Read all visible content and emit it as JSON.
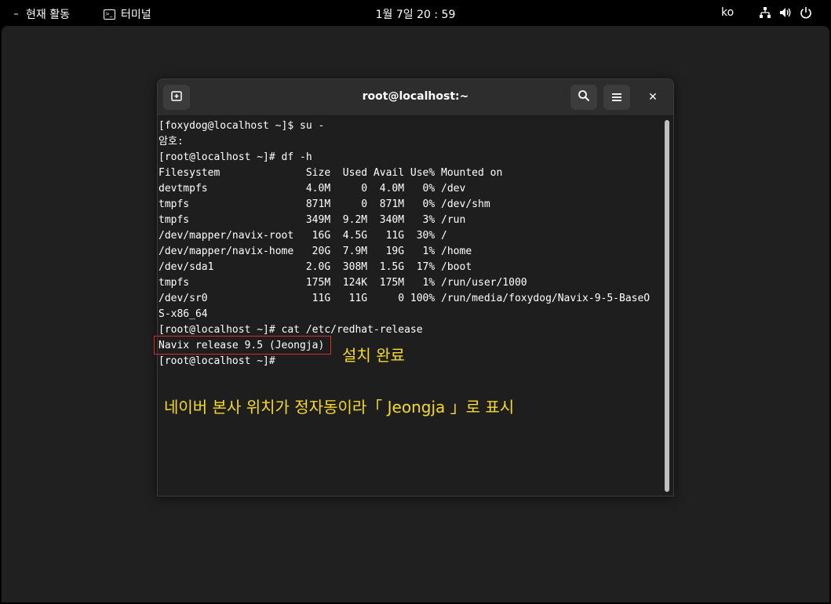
{
  "topbar": {
    "activities_label": "현재 활동",
    "app_name": "터미널",
    "clock": "1월 7일  20 : 59",
    "language": "ko",
    "tray_icons": [
      "network-icon",
      "volume-icon",
      "power-icon"
    ]
  },
  "window": {
    "title": "root@localhost:~",
    "buttons": [
      "new-tab-icon",
      "search-icon",
      "hamburger-menu-icon",
      "close-icon"
    ],
    "close_glyph": "✕"
  },
  "terminal": {
    "lines": [
      "[foxydog@localhost ~]$ su -",
      "암호:",
      "[root@localhost ~]# df -h",
      "Filesystem              Size  Used Avail Use% Mounted on",
      "devtmpfs                4.0M     0  4.0M   0% /dev",
      "tmpfs                   871M     0  871M   0% /dev/shm",
      "tmpfs                   349M  9.2M  340M   3% /run",
      "/dev/mapper/navix-root   16G  4.5G   11G  30% /",
      "/dev/mapper/navix-home   20G  7.9M   19G   1% /home",
      "/dev/sda1               2.0G  308M  1.5G  17% /boot",
      "tmpfs                   175M  124K  175M   1% /run/user/1000",
      "/dev/sr0                 11G   11G     0 100% /run/media/foxydog/Navix-9-5-BaseO",
      "S-x86_64",
      "[root@localhost ~]# cat /etc/redhat-release",
      "Navix release 9.5 (Jeongja)",
      "[root@localhost ~]# "
    ]
  },
  "annotations": {
    "install_done": "설치 완료",
    "note": "네이버 본사 위치가 정자동이라「 Jeongja 」로 표시"
  },
  "colors": {
    "annotation_text": "#f7dc1f",
    "highlight_border": "#d92b2b",
    "terminal_bg": "#1e1e1e",
    "headerbar_bg": "#2d2d2d"
  }
}
